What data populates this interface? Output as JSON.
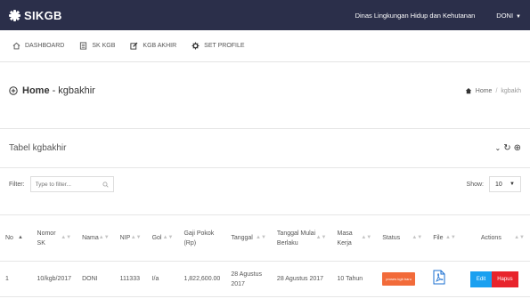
{
  "app": {
    "brand": "SIKGB"
  },
  "topbar": {
    "agency": "Dinas Lingkungan Hidup dan Kehutanan",
    "user": "DONI"
  },
  "nav": [
    {
      "label": "DASHBOARD",
      "icon": "home-icon"
    },
    {
      "label": "SK KGB",
      "icon": "document-icon"
    },
    {
      "label": "KGB AKHIR",
      "icon": "edit-icon"
    },
    {
      "label": "SET PROFILE",
      "icon": "gear-icon"
    }
  ],
  "page": {
    "title_home": "Home",
    "title_separator": "-",
    "title_page": "kgbakhir"
  },
  "breadcrumb": {
    "home": "Home",
    "separator": "/",
    "current": "kgbakh"
  },
  "card": {
    "title": "Tabel kgbakhir"
  },
  "filter": {
    "label": "Filter:",
    "placeholder": "Type to filter..."
  },
  "show": {
    "label": "Show:",
    "value": "10"
  },
  "table": {
    "headers": [
      {
        "key": "no",
        "label": "No",
        "sort": "▲"
      },
      {
        "key": "nomor_sk",
        "label": "Nomor SK",
        "sort": "▲▼"
      },
      {
        "key": "nama",
        "label": "Nama",
        "sort": "▲▼"
      },
      {
        "key": "nip",
        "label": "NIP",
        "sort": "▲▼"
      },
      {
        "key": "gol",
        "label": "Gol",
        "sort": "▲▼"
      },
      {
        "key": "gaji_pokok",
        "label": "Gaji Pokok (Rp)",
        "sort": ""
      },
      {
        "key": "tanggal",
        "label": "Tanggal",
        "sort": "▲▼"
      },
      {
        "key": "tanggal_mulai",
        "label": "Tanggal Mulai Berlaku",
        "sort": "▲▼"
      },
      {
        "key": "masa_kerja",
        "label": "Masa Kerja",
        "sort": "▲▼"
      },
      {
        "key": "status",
        "label": "Status",
        "sort": "▲▼"
      },
      {
        "key": "file",
        "label": "File",
        "sort": "▲▼"
      },
      {
        "key": "actions",
        "label": "Actions",
        "sort": "▲▼"
      }
    ],
    "rows": [
      {
        "no": "1",
        "nomor_sk": "10/kgb/2017",
        "nama": "DONI",
        "nip": "111333",
        "gol": "I/a",
        "gaji_pokok": "1,822,600.00",
        "tanggal": "28 Agustus 2017",
        "tanggal_mulai": "28 Agustus 2017",
        "masa_kerja": "10 Tahun",
        "status": "proses kgb baru",
        "file_icon": "pdf-icon",
        "edit_label": "Edit",
        "delete_label": "Hapus"
      }
    ]
  },
  "colors": {
    "topbar": "#2b2f4a",
    "status_badge": "#f26b3a",
    "edit_button": "#1aa0f0",
    "delete_button": "#e8242c",
    "pdf_icon": "#1a6fd0"
  }
}
